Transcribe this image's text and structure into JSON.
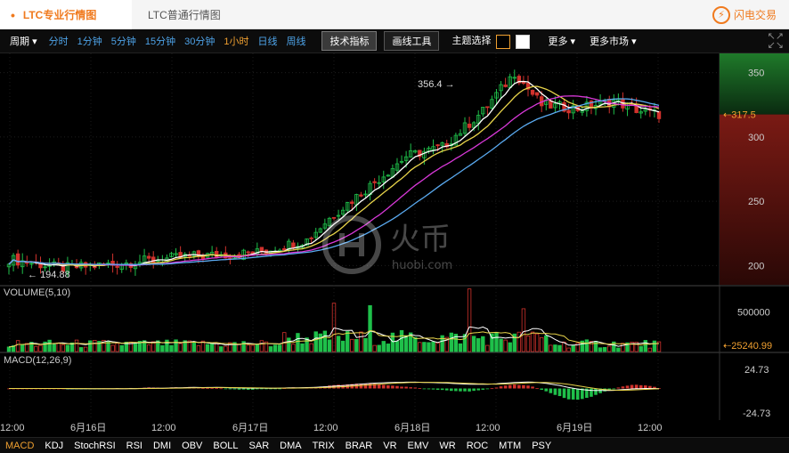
{
  "tabs": {
    "active": "LTC专业行情图",
    "other": "LTC普通行情图",
    "brand": "闪电交易"
  },
  "toolbar": {
    "period_label": "周期",
    "times": [
      "分时",
      "1分钟",
      "5分钟",
      "15分钟",
      "30分钟",
      "1小时",
      "日线",
      "周线"
    ],
    "active_time": "1小时",
    "tech_indicator": "技术指标",
    "drawing_tools": "画线工具",
    "theme_label": "主题选择",
    "more": "更多",
    "more_markets": "更多市场"
  },
  "indicators": [
    "MACD",
    "KDJ",
    "StochRSI",
    "RSI",
    "DMI",
    "OBV",
    "BOLL",
    "SAR",
    "DMA",
    "TRIX",
    "BRAR",
    "VR",
    "EMV",
    "WR",
    "ROC",
    "MTM",
    "PSY"
  ],
  "active_indicator": "MACD",
  "watermark": {
    "name": "火币",
    "domain": "huobi.com"
  },
  "colors": {
    "up": "#d2322d",
    "down": "#1fc04a",
    "accent": "#f0a030",
    "ma1": "#ffffff",
    "ma2": "#e8d44a",
    "ma3": "#d838d8",
    "ma4": "#5aaaf0"
  },
  "chart_data": {
    "type": "candlestick",
    "price_axis": {
      "ticks": [
        200,
        250,
        300,
        350
      ],
      "ylim": [
        185,
        365
      ]
    },
    "high_label": "356.4",
    "low_label": "194.88",
    "current_price": "317.5",
    "volume_title": "VOLUME(5,10)",
    "volume_axis": {
      "ticks": [
        {
          "value": 500000,
          "label": "500000"
        }
      ],
      "current": "25240.99",
      "ylim": [
        0,
        820000
      ]
    },
    "macd_title": "MACD(12,26,9)",
    "macd_axis": {
      "ticks": [
        "24.73",
        "-24.73"
      ],
      "ylim": [
        -24.73,
        24.73
      ]
    },
    "x_labels": [
      "12:00",
      "6月16日",
      "12:00",
      "6月17日",
      "12:00",
      "6月18日",
      "12:00",
      "6月19日",
      "12:00"
    ]
  }
}
